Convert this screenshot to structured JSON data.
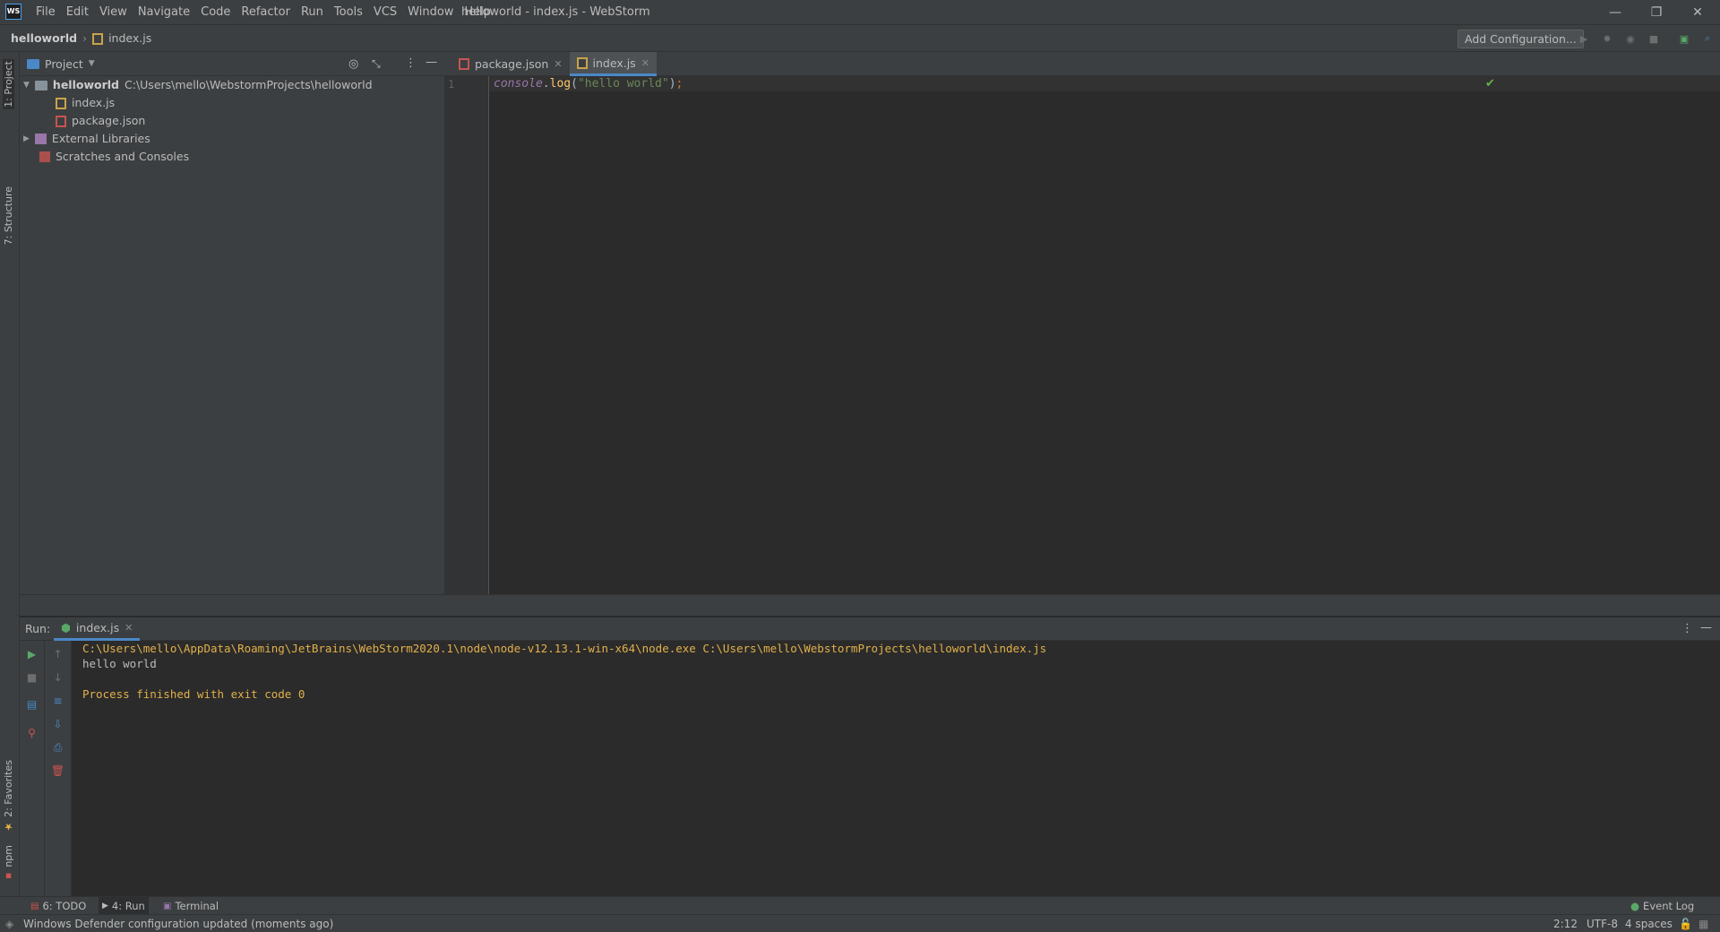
{
  "app": {
    "logo": "WS",
    "title": "helloworld - index.js - WebStorm"
  },
  "menu": [
    "File",
    "Edit",
    "View",
    "Navigate",
    "Code",
    "Refactor",
    "Run",
    "Tools",
    "VCS",
    "Window",
    "Help"
  ],
  "window_controls": {
    "minimize": "—",
    "restore": "❐",
    "close": "✕"
  },
  "navbar": {
    "project": "helloworld",
    "separator": "›",
    "file": "index.js",
    "add_configuration": "Add Configuration..."
  },
  "left_stripe": {
    "project": "1: Project",
    "structure": "7: Structure",
    "favorites": "2: Favorites",
    "npm": "npm"
  },
  "project_panel": {
    "title": "Project",
    "tree": {
      "root_name": "helloworld",
      "root_path": "C:\\Users\\mello\\WebstormProjects\\helloworld",
      "files": [
        "index.js",
        "package.json"
      ],
      "external": "External Libraries",
      "scratches": "Scratches and Consoles"
    }
  },
  "editor": {
    "tabs": [
      {
        "label": "package.json",
        "icon": "json-file-icon",
        "close": "✕"
      },
      {
        "label": "index.js",
        "icon": "js-file-icon",
        "close": "✕"
      }
    ],
    "line_number": "1",
    "code": {
      "obj": "console",
      "dot": ".",
      "fn": "log",
      "open": "(",
      "str": "\"hello world\"",
      "close": ")",
      "semi": ";"
    },
    "inspection": "✔"
  },
  "run": {
    "label": "Run:",
    "tab": "index.js",
    "tab_close": "✕",
    "console": {
      "command": "C:\\Users\\mello\\AppData\\Roaming\\JetBrains\\WebStorm2020.1\\node\\node-v12.13.1-win-x64\\node.exe C:\\Users\\mello\\WebstormProjects\\helloworld\\index.js",
      "output": "hello world",
      "exit": "Process finished with exit code 0"
    }
  },
  "bottom_tabs": {
    "todo": "6: TODO",
    "run": "4: Run",
    "terminal": "Terminal",
    "event_log": "Event Log"
  },
  "status": {
    "message": "Windows Defender configuration updated (moments ago)",
    "position": "2:12",
    "encoding": "UTF-8",
    "indent": "4 spaces"
  }
}
